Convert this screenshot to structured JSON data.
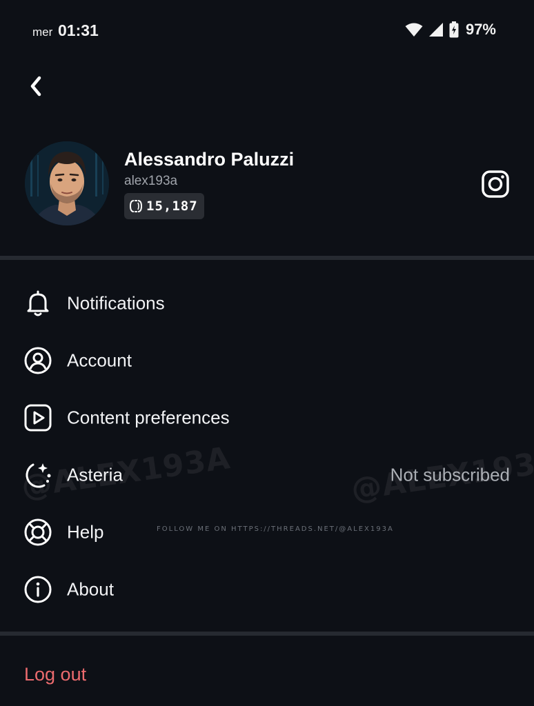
{
  "status_bar": {
    "day": "mer",
    "time": "01:31",
    "battery_percent": "97%",
    "icons": [
      "wifi-icon",
      "cellular-signal-icon",
      "battery-charging-icon"
    ]
  },
  "header": {
    "back_icon": "chevron-left-icon"
  },
  "profile": {
    "name": "Alessandro Paluzzi",
    "handle": "alex193a",
    "points": "15,187",
    "points_icon": "coin-icon",
    "social_icon": "instagram-icon"
  },
  "menu": {
    "items": [
      {
        "label": "Notifications",
        "icon": "bell-icon",
        "value": ""
      },
      {
        "label": "Account",
        "icon": "user-circle-icon",
        "value": ""
      },
      {
        "label": "Content preferences",
        "icon": "play-square-icon",
        "value": ""
      },
      {
        "label": "Asteria",
        "icon": "sparkle-circle-icon",
        "value": "Not subscribed"
      },
      {
        "label": "Help",
        "icon": "lifebuoy-icon",
        "value": ""
      },
      {
        "label": "About",
        "icon": "info-icon",
        "value": ""
      }
    ]
  },
  "logout_label": "Log out",
  "watermark": {
    "text": "@ALEX193A",
    "follow": "FOLLOW ME ON HTTPS://THREADS.NET/@ALEX193A"
  },
  "colors": {
    "background": "#0d1016",
    "divider": "#262a31",
    "logout": "#ec6b6e",
    "secondary_text": "#a0a4ab"
  }
}
